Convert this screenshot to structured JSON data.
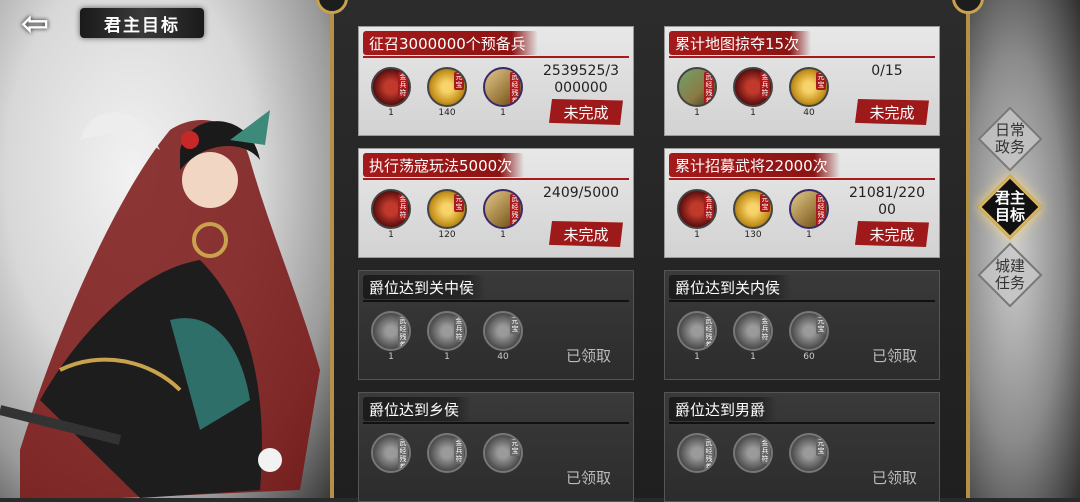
{
  "header": {
    "title": "君主目标",
    "back_icon": "back-arrow-icon"
  },
  "colors": {
    "accent_red": "#a51a1a",
    "gold": "#c9a24e",
    "panel_dark": "#2a2a2a"
  },
  "side_tabs": [
    {
      "label": "日常政务",
      "line1": "日常",
      "line2": "政务",
      "active": false
    },
    {
      "label": "君主目标",
      "line1": "君主",
      "line2": "目标",
      "active": true
    },
    {
      "label": "城建任务",
      "line1": "城建",
      "line2": "任务",
      "active": false
    }
  ],
  "tasks": [
    {
      "title": "征召3000000个预备兵",
      "progress_line1": "2539525/3",
      "progress_line2": "000000",
      "status": "未完成",
      "rewards": [
        {
          "icon": "bingfu-icon",
          "tag": "金兵符",
          "count": "1"
        },
        {
          "icon": "yuanbao-icon",
          "tag": "元宝",
          "count": "140"
        },
        {
          "icon": "scroll-icon",
          "tag": "武经残卷",
          "count": "1"
        }
      ]
    },
    {
      "title": "累计地图掠夺15次",
      "progress_line1": "0/15",
      "progress_line2": "",
      "status": "未完成",
      "rewards": [
        {
          "icon": "map-icon",
          "tag": "武经残卷",
          "count": "1"
        },
        {
          "icon": "bingfu-icon",
          "tag": "金兵符",
          "count": "1"
        },
        {
          "icon": "yuanbao-icon",
          "tag": "元宝",
          "count": "40"
        }
      ]
    },
    {
      "title": "执行荡寇玩法5000次",
      "progress_line1": "2409/5000",
      "progress_line2": "",
      "status": "未完成",
      "rewards": [
        {
          "icon": "bingfu-icon",
          "tag": "金兵符",
          "count": "1"
        },
        {
          "icon": "yuanbao-icon",
          "tag": "元宝",
          "count": "120"
        },
        {
          "icon": "scroll-icon",
          "tag": "武经残卷",
          "count": "1"
        }
      ]
    },
    {
      "title": "累计招募武将22000次",
      "progress_line1": "21081/220",
      "progress_line2": "00",
      "status": "未完成",
      "rewards": [
        {
          "icon": "bingfu-icon",
          "tag": "金兵符",
          "count": "1"
        },
        {
          "icon": "yuanbao-icon",
          "tag": "元宝",
          "count": "130"
        },
        {
          "icon": "scroll-icon",
          "tag": "武经残卷",
          "count": "1"
        }
      ]
    },
    {
      "title": "爵位达到关中侯",
      "status": "已领取",
      "rewards": [
        {
          "icon": "scroll-icon",
          "tag": "武经残卷",
          "count": "1"
        },
        {
          "icon": "bingfu-icon",
          "tag": "金兵符",
          "count": "1"
        },
        {
          "icon": "yuanbao-icon",
          "tag": "元宝",
          "count": "40"
        }
      ]
    },
    {
      "title": "爵位达到关内侯",
      "status": "已领取",
      "rewards": [
        {
          "icon": "scroll-icon",
          "tag": "武经残卷",
          "count": "1"
        },
        {
          "icon": "bingfu-icon",
          "tag": "金兵符",
          "count": "1"
        },
        {
          "icon": "yuanbao-icon",
          "tag": "元宝",
          "count": "60"
        }
      ]
    },
    {
      "title": "爵位达到乡侯",
      "status": "已领取",
      "rewards": [
        {
          "icon": "scroll-icon",
          "tag": "武经残卷",
          "count": ""
        },
        {
          "icon": "bingfu-icon",
          "tag": "金兵符",
          "count": ""
        },
        {
          "icon": "yuanbao-icon",
          "tag": "元宝",
          "count": ""
        }
      ]
    },
    {
      "title": "爵位达到男爵",
      "status": "已领取",
      "rewards": [
        {
          "icon": "scroll-icon",
          "tag": "武经残卷",
          "count": ""
        },
        {
          "icon": "bingfu-icon",
          "tag": "金兵符",
          "count": ""
        },
        {
          "icon": "yuanbao-icon",
          "tag": "元宝",
          "count": ""
        }
      ]
    }
  ]
}
